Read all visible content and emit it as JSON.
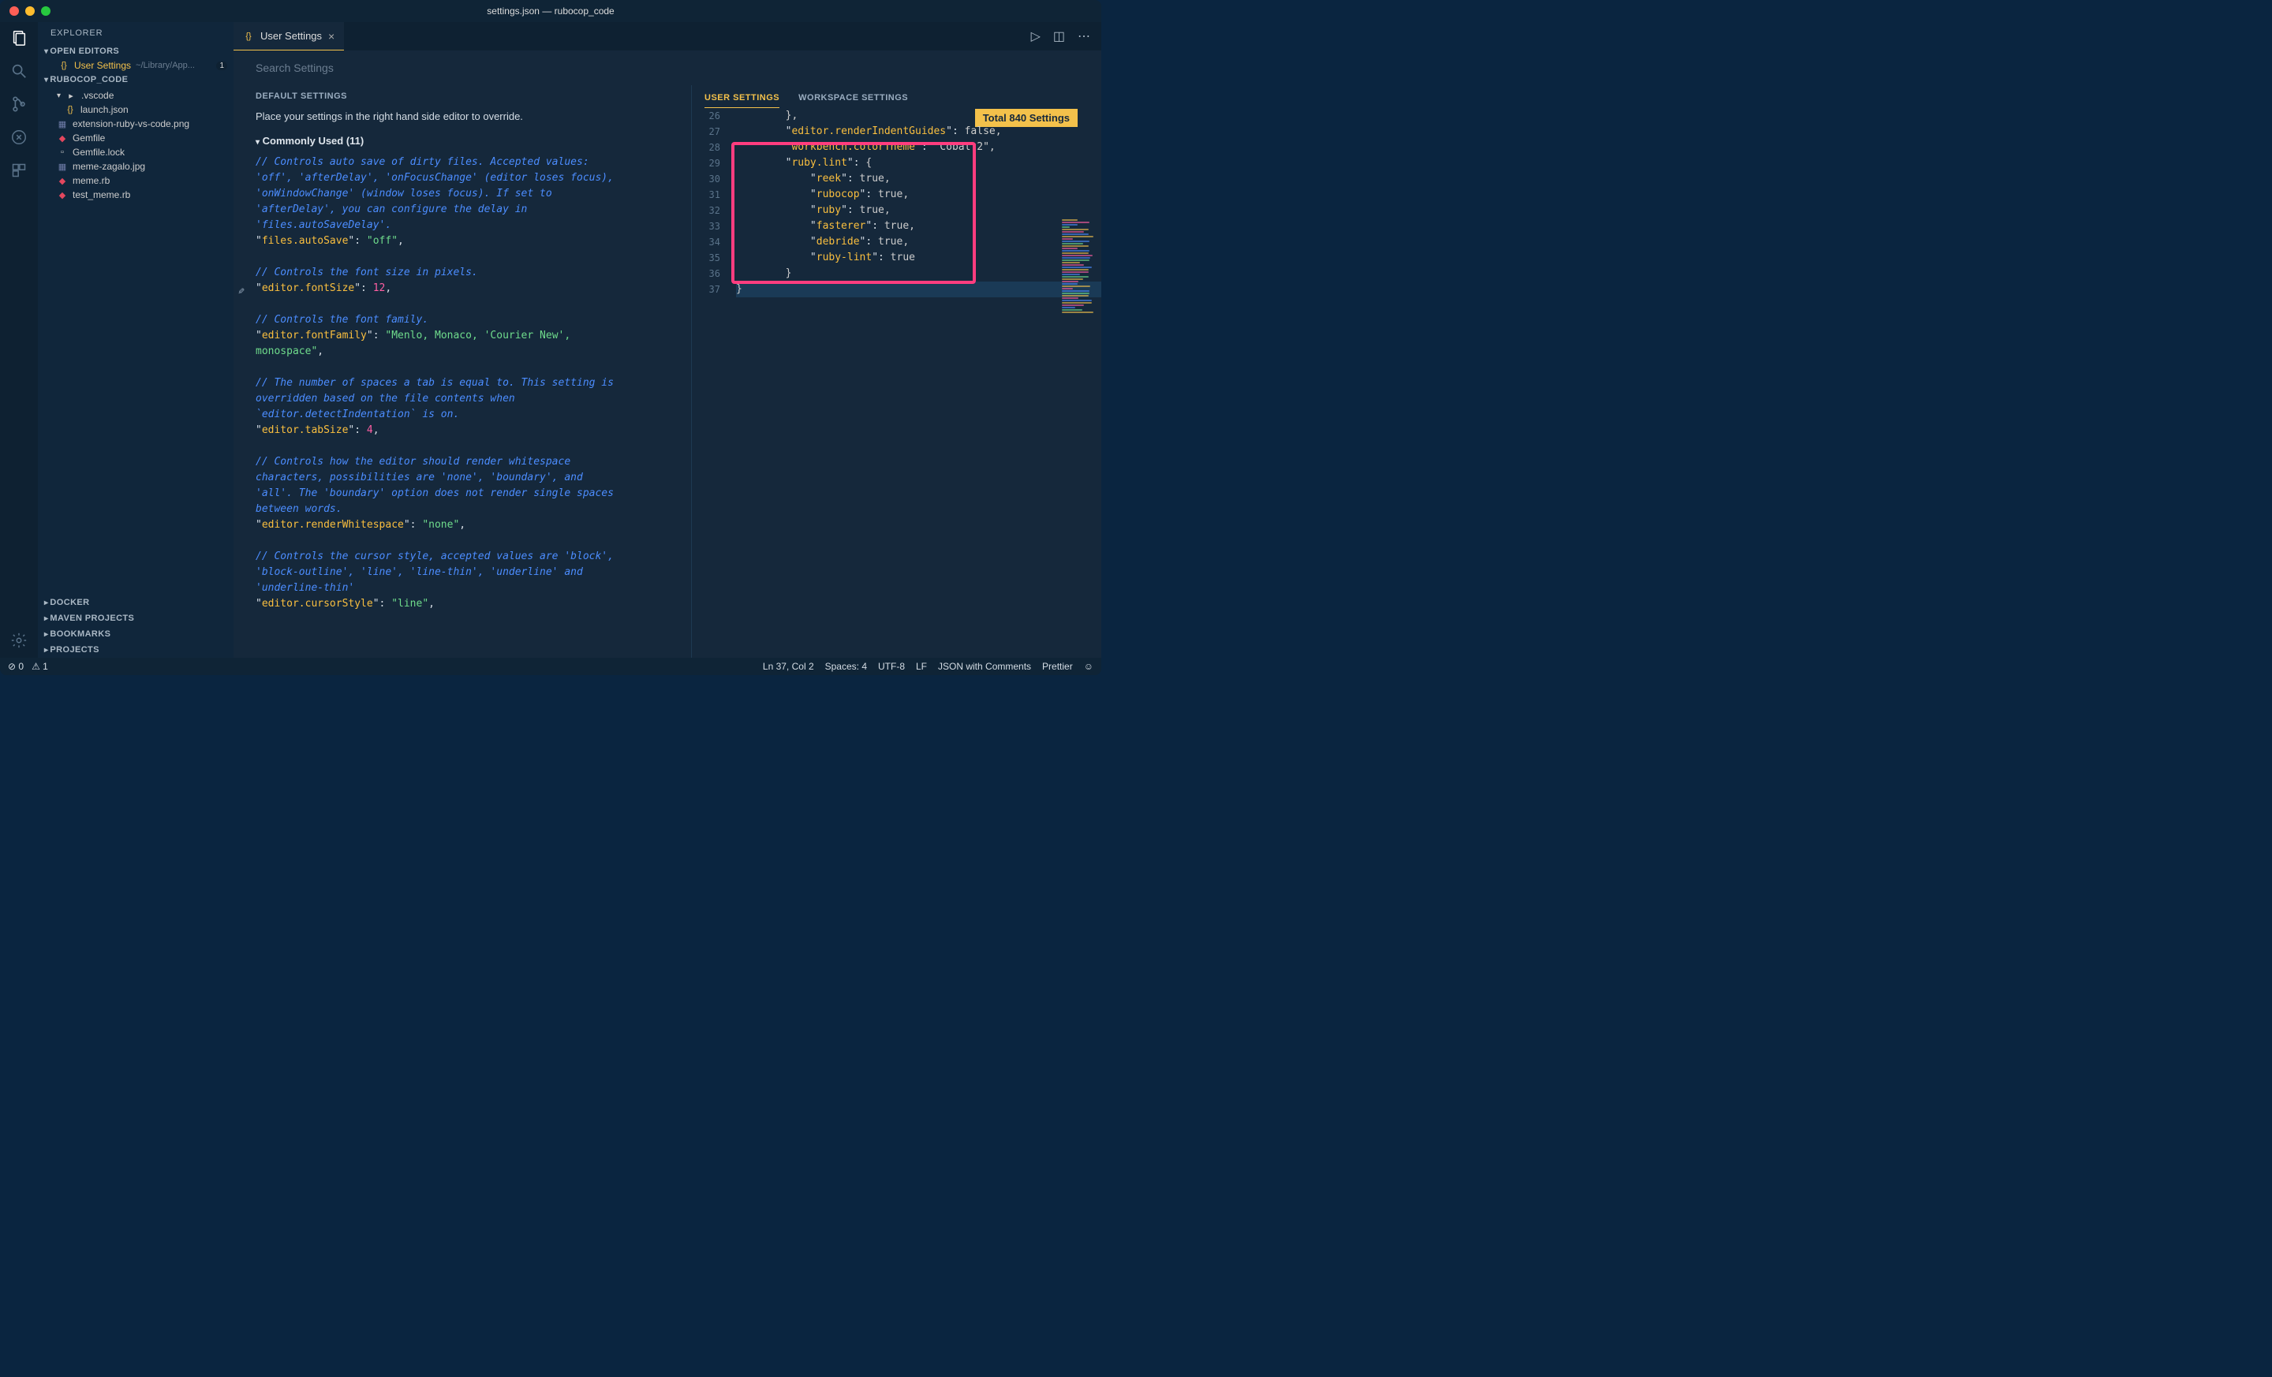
{
  "title": "settings.json — rubocop_code",
  "sidebar": {
    "header": "EXPLORER",
    "openEditorsLabel": "OPEN EDITORS",
    "openItem": {
      "name": "User Settings",
      "path": "~/Library/App...",
      "badge": "1"
    },
    "projectLabel": "RUBOCOP_CODE",
    "tree": [
      {
        "label": ".vscode",
        "type": "folder",
        "depth": 1
      },
      {
        "label": "launch.json",
        "type": "json",
        "depth": 2
      },
      {
        "label": "extension-ruby-vs-code.png",
        "type": "img",
        "depth": 1
      },
      {
        "label": "Gemfile",
        "type": "rb",
        "depth": 1
      },
      {
        "label": "Gemfile.lock",
        "type": "file",
        "depth": 1
      },
      {
        "label": "meme-zagalo.jpg",
        "type": "img",
        "depth": 1
      },
      {
        "label": "meme.rb",
        "type": "rb",
        "depth": 1
      },
      {
        "label": "test_meme.rb",
        "type": "rb",
        "depth": 1
      }
    ],
    "bottom": [
      "DOCKER",
      "MAVEN PROJECTS",
      "BOOKMARKS",
      "PROJECTS"
    ]
  },
  "tab": {
    "label": "User Settings"
  },
  "search": {
    "placeholder": "Search Settings"
  },
  "totalBadge": "Total 840 Settings",
  "defaults": {
    "header": "DEFAULT SETTINGS",
    "subtitle": "Place your settings in the right hand side editor to override.",
    "commonly": "Commonly Used (11)",
    "lines": [
      {
        "t": "cm",
        "v": "// Controls auto save of dirty files. Accepted values:"
      },
      {
        "t": "cm",
        "v": "'off', 'afterDelay', 'onFocusChange' (editor loses focus),"
      },
      {
        "t": "cm",
        "v": "'onWindowChange' (window loses focus). If set to"
      },
      {
        "t": "cm",
        "v": "'afterDelay', you can configure the delay in"
      },
      {
        "t": "cm",
        "v": "'files.autoSaveDelay'."
      },
      {
        "t": "kv",
        "k": "files.autoSave",
        "s": "off"
      },
      {
        "t": "blank"
      },
      {
        "t": "cm",
        "v": "// Controls the font size in pixels."
      },
      {
        "t": "kv",
        "k": "editor.fontSize",
        "n": "12"
      },
      {
        "t": "blank"
      },
      {
        "t": "cm",
        "v": "// Controls the font family."
      },
      {
        "t": "kv2",
        "k": "editor.fontFamily",
        "s": "Menlo, Monaco, 'Courier New',",
        "cont": "monospace"
      },
      {
        "t": "blank"
      },
      {
        "t": "cm",
        "v": "// The number of spaces a tab is equal to. This setting is"
      },
      {
        "t": "cm",
        "v": "overridden based on the file contents when"
      },
      {
        "t": "cm",
        "v": "`editor.detectIndentation` is on."
      },
      {
        "t": "kv",
        "k": "editor.tabSize",
        "n": "4"
      },
      {
        "t": "blank"
      },
      {
        "t": "cm",
        "v": "// Controls how the editor should render whitespace"
      },
      {
        "t": "cm",
        "v": "characters, possibilities are 'none', 'boundary', and"
      },
      {
        "t": "cm",
        "v": "'all'. The 'boundary' option does not render single spaces"
      },
      {
        "t": "cm",
        "v": "between words."
      },
      {
        "t": "kv",
        "k": "editor.renderWhitespace",
        "s": "none"
      },
      {
        "t": "blank"
      },
      {
        "t": "cm",
        "v": "// Controls the cursor style, accepted values are 'block',"
      },
      {
        "t": "cm",
        "v": "'block-outline', 'line', 'line-thin', 'underline' and"
      },
      {
        "t": "cm",
        "v": "'underline-thin'"
      },
      {
        "t": "kv",
        "k": "editor.cursorStyle",
        "s": "line"
      }
    ]
  },
  "userSettings": {
    "tabs": [
      "USER SETTINGS",
      "WORKSPACE SETTINGS"
    ],
    "startLine": 26,
    "lines": [
      "        },",
      "        \"editor.renderIndentGuides\": false,",
      "        \"workbench.colorTheme\": \"Cobalt2\",",
      "        \"ruby.lint\": {",
      "            \"reek\": true,",
      "            \"rubocop\": true,",
      "            \"ruby\": true,",
      "            \"fasterer\": true,",
      "            \"debride\": true,",
      "            \"ruby-lint\": true",
      "        }",
      "}"
    ]
  },
  "status": {
    "left": [
      "⊘ 0",
      "⚠ 1"
    ],
    "right": [
      "Ln 37, Col 2",
      "Spaces: 4",
      "UTF-8",
      "LF",
      "JSON with Comments",
      "Prettier",
      "☺"
    ]
  }
}
